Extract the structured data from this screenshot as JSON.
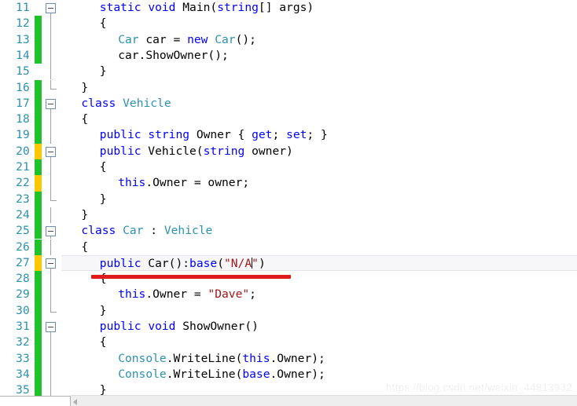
{
  "editor": {
    "language": "csharp",
    "first_line_number": 11,
    "current_line_number": 27,
    "colors": {
      "keyword": "#0000ff",
      "type": "#2b91af",
      "string": "#a31515",
      "plain": "#000000",
      "line_number": "#2b91af",
      "change_added": "#1fc22a",
      "change_modified": "#ffc700",
      "annotation_underline": "#e01b1b",
      "current_line_background": "#f7f7f9",
      "background": "#ffffff"
    },
    "lines": [
      {
        "number": "11",
        "indent": 2,
        "change": "none",
        "fold": "open",
        "tokens": [
          {
            "t": "static",
            "c": "kw"
          },
          {
            "t": " ",
            "c": "pl"
          },
          {
            "t": "void",
            "c": "kw"
          },
          {
            "t": " Main(",
            "c": "pl"
          },
          {
            "t": "string",
            "c": "kw"
          },
          {
            "t": "[] args)",
            "c": "pl"
          }
        ]
      },
      {
        "number": "12",
        "indent": 2,
        "change": "green",
        "fold": "line",
        "tokens": [
          {
            "t": "{",
            "c": "pl"
          }
        ]
      },
      {
        "number": "13",
        "indent": 3,
        "change": "green",
        "fold": "line",
        "tokens": [
          {
            "t": "Car",
            "c": "type"
          },
          {
            "t": " car = ",
            "c": "pl"
          },
          {
            "t": "new",
            "c": "kw"
          },
          {
            "t": " ",
            "c": "pl"
          },
          {
            "t": "Car",
            "c": "type"
          },
          {
            "t": "();",
            "c": "pl"
          }
        ]
      },
      {
        "number": "14",
        "indent": 3,
        "change": "green",
        "fold": "line",
        "tokens": [
          {
            "t": "car.ShowOwner();",
            "c": "pl"
          }
        ]
      },
      {
        "number": "15",
        "indent": 2,
        "change": "none",
        "fold": "line",
        "tokens": [
          {
            "t": "}",
            "c": "pl"
          }
        ]
      },
      {
        "number": "16",
        "indent": 1,
        "change": "green",
        "fold": "end",
        "tokens": [
          {
            "t": "}",
            "c": "pl"
          }
        ]
      },
      {
        "number": "17",
        "indent": 1,
        "change": "green",
        "fold": "open",
        "tokens": [
          {
            "t": "class",
            "c": "kw"
          },
          {
            "t": " ",
            "c": "pl"
          },
          {
            "t": "Vehicle",
            "c": "type"
          }
        ]
      },
      {
        "number": "18",
        "indent": 1,
        "change": "green",
        "fold": "line",
        "tokens": [
          {
            "t": "{",
            "c": "pl"
          }
        ]
      },
      {
        "number": "19",
        "indent": 2,
        "change": "green",
        "fold": "line",
        "tokens": [
          {
            "t": "public",
            "c": "kw"
          },
          {
            "t": " ",
            "c": "pl"
          },
          {
            "t": "string",
            "c": "kw"
          },
          {
            "t": " Owner { ",
            "c": "pl"
          },
          {
            "t": "get",
            "c": "kw"
          },
          {
            "t": "; ",
            "c": "pl"
          },
          {
            "t": "set",
            "c": "kw"
          },
          {
            "t": "; }",
            "c": "pl"
          }
        ]
      },
      {
        "number": "20",
        "indent": 2,
        "change": "yellow",
        "fold": "open",
        "tokens": [
          {
            "t": "public",
            "c": "kw"
          },
          {
            "t": " Vehicle(",
            "c": "pl"
          },
          {
            "t": "string",
            "c": "kw"
          },
          {
            "t": " owner)",
            "c": "pl"
          }
        ]
      },
      {
        "number": "21",
        "indent": 2,
        "change": "green",
        "fold": "line",
        "tokens": [
          {
            "t": "{",
            "c": "pl"
          }
        ]
      },
      {
        "number": "22",
        "indent": 3,
        "change": "yellow",
        "fold": "line",
        "tokens": [
          {
            "t": "this",
            "c": "kw"
          },
          {
            "t": ".Owner = owner;",
            "c": "pl"
          }
        ]
      },
      {
        "number": "23",
        "indent": 2,
        "change": "green",
        "fold": "end",
        "tokens": [
          {
            "t": "}",
            "c": "pl"
          }
        ]
      },
      {
        "number": "24",
        "indent": 1,
        "change": "green",
        "fold": "line",
        "tokens": [
          {
            "t": "}",
            "c": "pl"
          }
        ]
      },
      {
        "number": "25",
        "indent": 1,
        "change": "green",
        "fold": "open",
        "tokens": [
          {
            "t": "class",
            "c": "kw"
          },
          {
            "t": " ",
            "c": "pl"
          },
          {
            "t": "Car",
            "c": "type"
          },
          {
            "t": " : ",
            "c": "pl"
          },
          {
            "t": "Vehicle",
            "c": "type"
          }
        ]
      },
      {
        "number": "26",
        "indent": 1,
        "change": "green",
        "fold": "line",
        "tokens": [
          {
            "t": "{",
            "c": "pl"
          }
        ]
      },
      {
        "number": "27",
        "indent": 2,
        "change": "yellow",
        "fold": "open",
        "current": true,
        "tokens": [
          {
            "t": "public",
            "c": "kw"
          },
          {
            "t": " Car():",
            "c": "pl"
          },
          {
            "t": "base",
            "c": "kw"
          },
          {
            "t": "(",
            "c": "pl"
          },
          {
            "t": "\"N/A",
            "c": "str"
          },
          {
            "t": "CARET",
            "c": "caret"
          },
          {
            "t": "\"",
            "c": "str"
          },
          {
            "t": ")",
            "c": "pl"
          }
        ]
      },
      {
        "number": "28",
        "indent": 2,
        "change": "green",
        "fold": "line",
        "tokens": [
          {
            "t": "{",
            "c": "pl"
          }
        ]
      },
      {
        "number": "29",
        "indent": 3,
        "change": "green",
        "fold": "line",
        "tokens": [
          {
            "t": "this",
            "c": "kw"
          },
          {
            "t": ".Owner = ",
            "c": "pl"
          },
          {
            "t": "\"Dave\"",
            "c": "str"
          },
          {
            "t": ";",
            "c": "pl"
          }
        ]
      },
      {
        "number": "30",
        "indent": 2,
        "change": "green",
        "fold": "end",
        "tokens": [
          {
            "t": "}",
            "c": "pl"
          }
        ]
      },
      {
        "number": "31",
        "indent": 2,
        "change": "green",
        "fold": "open",
        "tokens": [
          {
            "t": "public",
            "c": "kw"
          },
          {
            "t": " ",
            "c": "pl"
          },
          {
            "t": "void",
            "c": "kw"
          },
          {
            "t": " ShowOwner()",
            "c": "pl"
          }
        ]
      },
      {
        "number": "32",
        "indent": 2,
        "change": "green",
        "fold": "line",
        "tokens": [
          {
            "t": "{",
            "c": "pl"
          }
        ]
      },
      {
        "number": "33",
        "indent": 3,
        "change": "green",
        "fold": "line",
        "tokens": [
          {
            "t": "Console",
            "c": "type"
          },
          {
            "t": ".WriteLine(",
            "c": "pl"
          },
          {
            "t": "this",
            "c": "kw"
          },
          {
            "t": ".Owner);",
            "c": "pl"
          }
        ]
      },
      {
        "number": "34",
        "indent": 3,
        "change": "green",
        "fold": "line",
        "tokens": [
          {
            "t": "Console",
            "c": "type"
          },
          {
            "t": ".WriteLine(",
            "c": "pl"
          },
          {
            "t": "base",
            "c": "kw"
          },
          {
            "t": ".Owner);",
            "c": "pl"
          }
        ]
      },
      {
        "number": "35",
        "indent": 2,
        "change": "green",
        "fold": "line",
        "tokens": [
          {
            "t": "}",
            "c": "pl"
          }
        ]
      }
    ]
  },
  "annotation": {
    "type": "red-underline",
    "target_line": "27",
    "color": "#e01b1b"
  },
  "scrollbar": {
    "orientation": "horizontal",
    "position": "bottom"
  },
  "watermark": {
    "text": "https://blog.csdn.net/weixin_44813932"
  }
}
